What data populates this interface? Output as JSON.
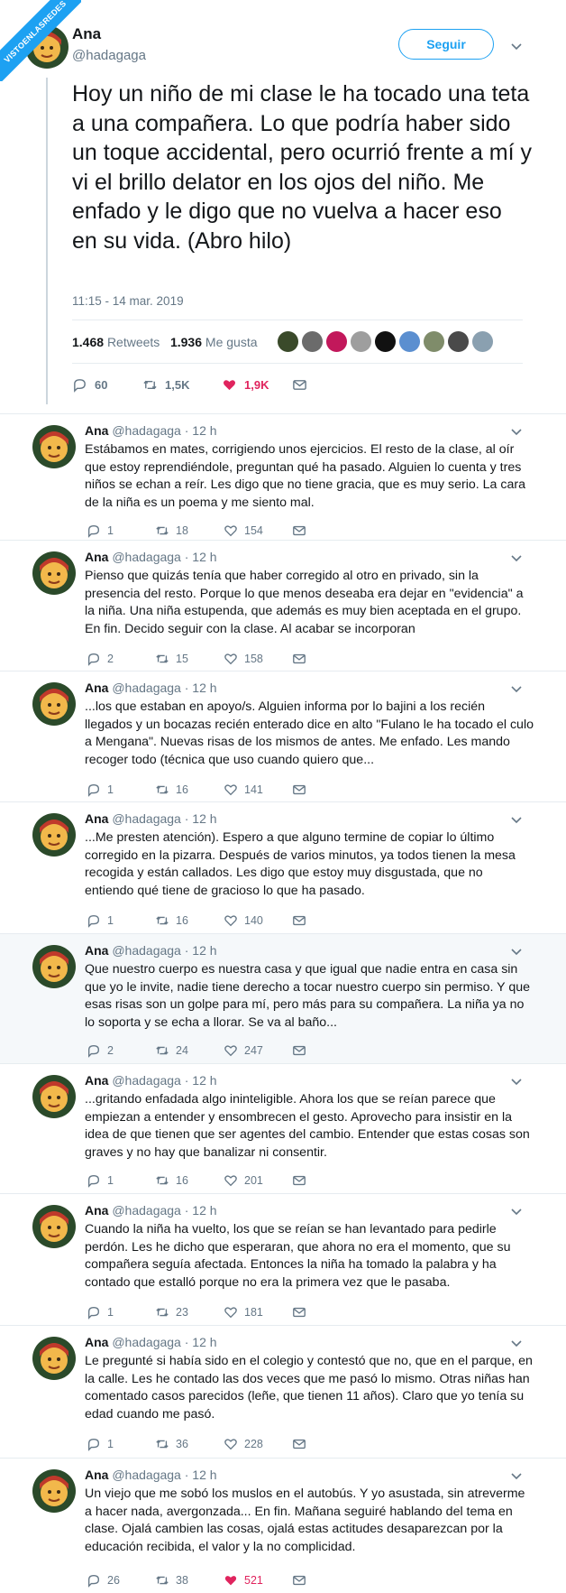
{
  "watermark": "VISTOENLASREDES",
  "main_tweet": {
    "name": "Ana",
    "handle": "@hadagaga",
    "follow_label": "Seguir",
    "text": "Hoy un niño de mi clase le ha tocado una teta a una compañera. Lo que podría haber sido un toque accidental, pero ocurrió frente a mí y vi el brillo delator en los ojos del niño. Me enfado y le digo que no vuelva a hacer eso en su vida. (Abro hilo)",
    "timestamp": "11:15 - 14 mar. 2019",
    "retweets": "1.468",
    "retweets_label": "Retweets",
    "likes": "1.936",
    "likes_label": "Me gusta",
    "actions": {
      "replies": "60",
      "retweets": "1,5K",
      "likes": "1,9K"
    },
    "colors": {
      "accent": "#1da1f2",
      "like": "#e0245e",
      "muted": "#657786"
    }
  },
  "replies": [
    {
      "name": "Ana",
      "meta": "@hadagaga · 12 h",
      "text": "Estábamos en mates, corrigiendo unos ejercicios. El resto de la clase, al oír que estoy reprendiéndole, preguntan qué ha pasado. Alguien lo cuenta y tres niños se echan a reír. Les digo que no tiene gracia, que es muy serio. La cara de la niña es un poema y me siento mal.",
      "replies": "1",
      "retweets": "18",
      "likes": "154",
      "liked": false
    },
    {
      "name": "Ana",
      "meta": "@hadagaga · 12 h",
      "text": "Pienso que quizás tenía que haber corregido al otro en privado, sin la presencia del resto. Porque lo que menos deseaba era dejar en \"evidencia\" a la niña. Una niña estupenda, que además es muy bien aceptada en el grupo. En fin. Decido seguir con la clase. Al acabar se incorporan",
      "replies": "2",
      "retweets": "15",
      "likes": "158",
      "liked": false
    },
    {
      "name": "Ana",
      "meta": "@hadagaga · 12 h",
      "text": "...los que estaban en apoyo/s. Alguien informa por lo bajini a los recién llegados y un bocazas recién enterado dice en alto \"Fulano le ha tocado el culo a Mengana\". Nuevas risas de los mismos de antes. Me enfado. Les mando recoger todo (técnica que uso cuando quiero que...",
      "replies": "1",
      "retweets": "16",
      "likes": "141",
      "liked": false
    },
    {
      "name": "Ana",
      "meta": "@hadagaga · 12 h",
      "text": "...Me presten atención). Espero a que alguno termine de copiar lo último corregido en la pizarra. Después de varios minutos, ya todos tienen la mesa recogida y están callados. Les digo que estoy muy disgustada, que no entiendo qué tiene de gracioso lo que ha pasado.",
      "replies": "1",
      "retweets": "16",
      "likes": "140",
      "liked": false
    },
    {
      "name": "Ana",
      "meta": "@hadagaga · 12 h",
      "text": "Que nuestro cuerpo es nuestra casa y que igual que nadie entra en casa sin que yo le invite, nadie tiene derecho a tocar nuestro cuerpo sin permiso. Y que esas risas son un golpe para mí, pero más para su compañera. La niña ya no lo soporta y se echa a llorar. Se va al baño...",
      "replies": "2",
      "retweets": "24",
      "likes": "247",
      "liked": false
    },
    {
      "name": "Ana",
      "meta": "@hadagaga · 12 h",
      "text": "...gritando enfadada algo ininteligible. Ahora los que se reían parece que empiezan a entender y ensombrecen el gesto. Aprovecho para insistir en la idea de que tienen que ser agentes del cambio. Entender que estas cosas son graves y no hay que banalizar ni consentir.",
      "replies": "1",
      "retweets": "16",
      "likes": "201",
      "liked": false
    },
    {
      "name": "Ana",
      "meta": "@hadagaga · 12 h",
      "text": "Cuando la niña ha vuelto, los que se reían se han levantado para pedirle perdón. Les he dicho que esperaran, que ahora no era el momento, que su compañera seguía afectada. Entonces la niña ha tomado la palabra y ha contado que estalló porque no era la primera vez que le pasaba.",
      "replies": "1",
      "retweets": "23",
      "likes": "181",
      "liked": false
    },
    {
      "name": "Ana",
      "meta": "@hadagaga · 12 h",
      "text": "Le pregunté si había sido en el colegio y contestó que no, que en el parque, en la calle. Les he contado las dos veces que me pasó lo mismo. Otras niñas han comentado casos parecidos (leñe, que tienen 11 años). Claro que yo tenía su edad cuando me pasó.",
      "replies": "1",
      "retweets": "36",
      "likes": "228",
      "liked": false
    },
    {
      "name": "Ana",
      "meta": "@hadagaga · 12 h",
      "text": "Un viejo que me sobó los muslos en el autobús. Y yo asustada, sin atreverme a hacer nada, avergonzada... En fin. Mañana seguiré hablando del tema en clase. Ojalá cambien las cosas, ojalá estas actitudes desaparezcan por la educación recibida, el valor y la no complicidad.",
      "replies": "26",
      "retweets": "38",
      "likes": "521",
      "liked": true
    }
  ],
  "liker_colors": [
    "#3a4a2a",
    "#6b6b6b",
    "#c2185b",
    "#9e9e9e",
    "#111111",
    "#5b8fd0",
    "#7f8c6a",
    "#4a4a4a",
    "#8aa0b0"
  ]
}
